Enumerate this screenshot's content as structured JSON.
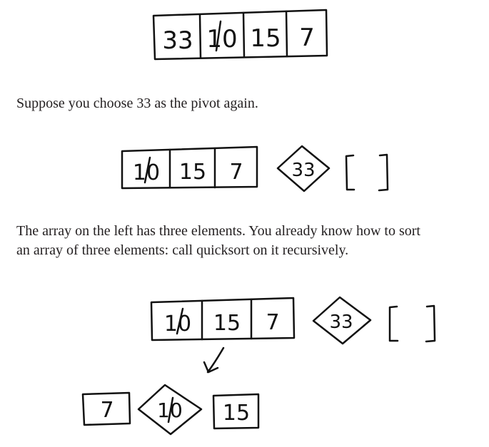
{
  "paragraphs": {
    "p1": "Suppose you choose 33 as the pivot again.",
    "p2_line1": "The array on the left has three elements. You already know how to sort",
    "p2_line2": "an array of three elements: call quicksort on it recursively."
  },
  "figure1": {
    "array": [
      "33",
      "10",
      "15",
      "7"
    ]
  },
  "figure2": {
    "left_array": [
      "10",
      "15",
      "7"
    ],
    "pivot": "33",
    "right_array": "[ ]"
  },
  "figure3": {
    "left_array": [
      "10",
      "15",
      "7"
    ],
    "pivot": "33",
    "right_array": "[ ]",
    "result_left": [
      "7"
    ],
    "result_pivot": "10",
    "result_right": [
      "15"
    ]
  },
  "colors": {
    "ink": "#111111",
    "text": "#231f20",
    "background": "#ffffff"
  },
  "icons": {
    "down_arrow": "checkmark-style-arrow-icon"
  }
}
